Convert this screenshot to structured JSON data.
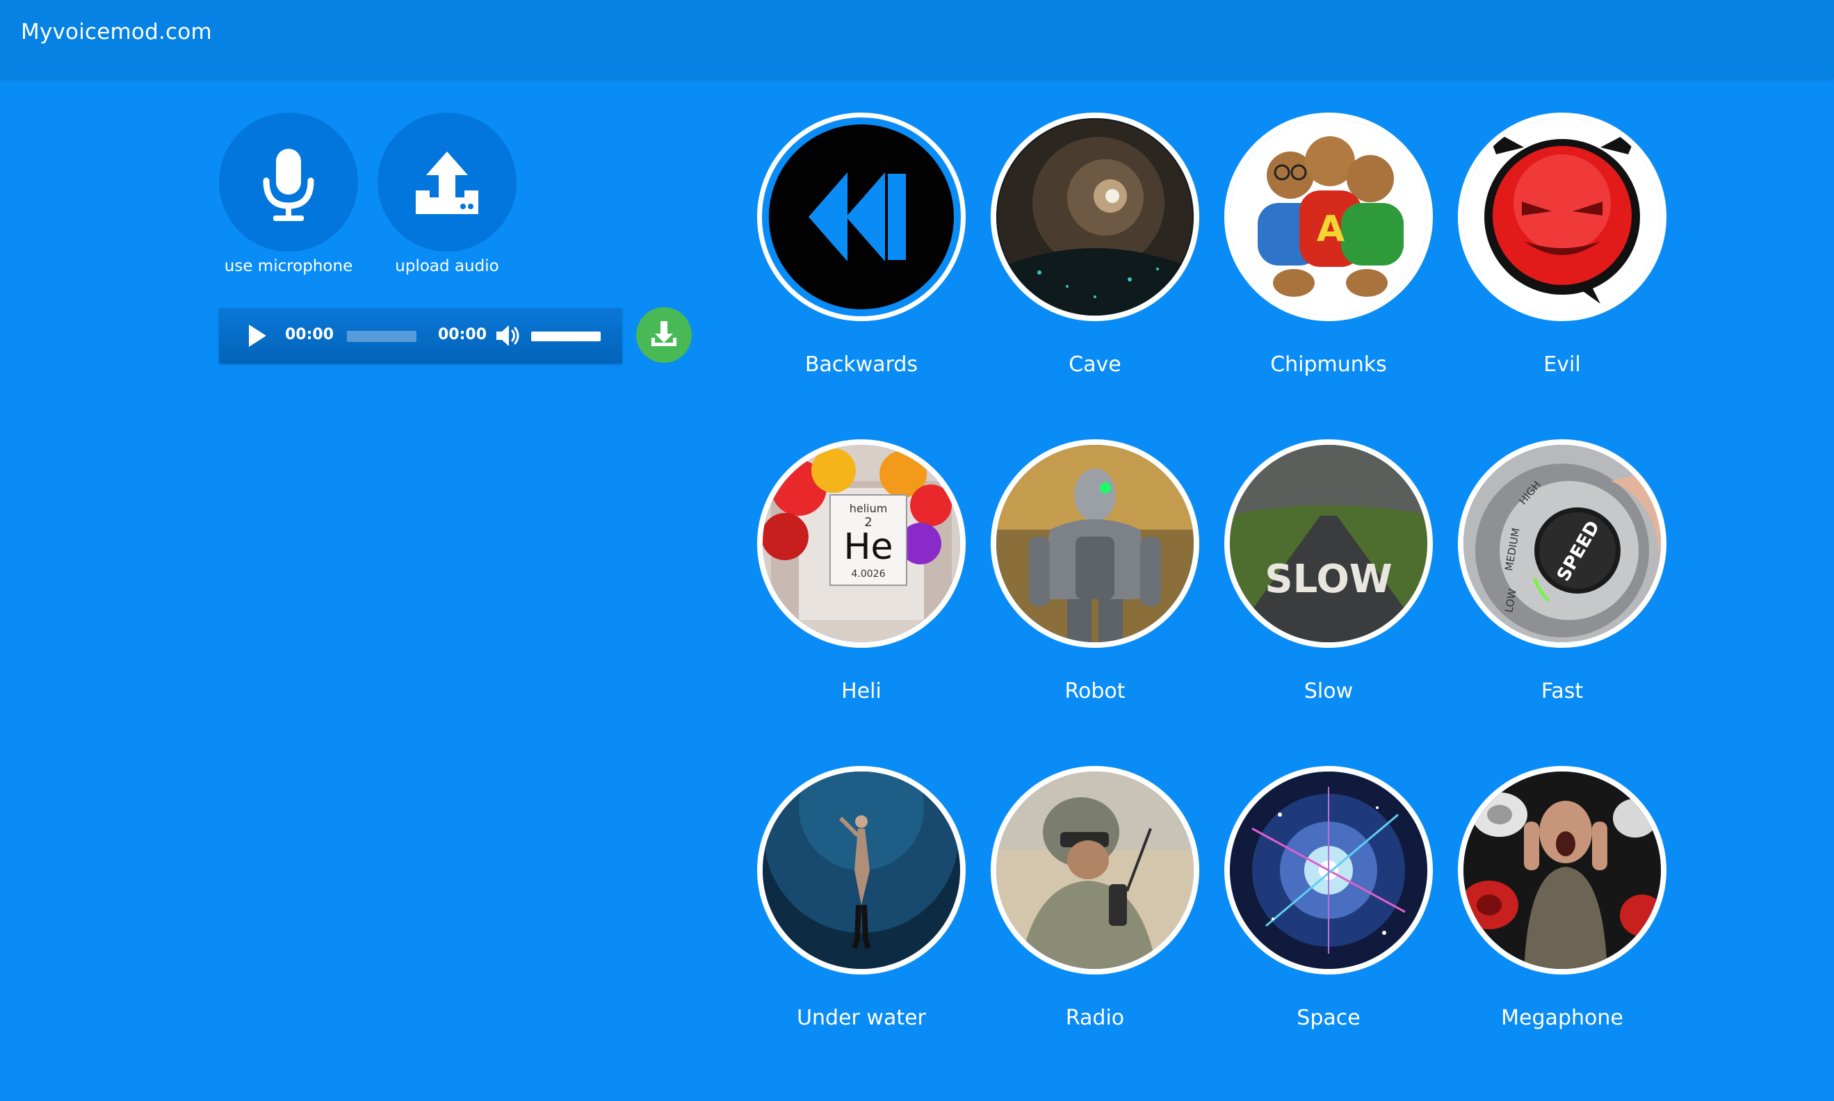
{
  "header": {
    "title": "Myvoicemod.com"
  },
  "inputs": [
    {
      "label": "use microphone",
      "icon": "microphone-icon"
    },
    {
      "label": "upload audio",
      "icon": "upload-icon"
    }
  ],
  "player": {
    "current_time": "00:00",
    "duration": "00:00",
    "progress": 0,
    "volume": 1.0
  },
  "download": {
    "icon": "download-icon",
    "color": "#48b954"
  },
  "effects": [
    {
      "label": "Backwards",
      "selected": true
    },
    {
      "label": "Cave"
    },
    {
      "label": "Chipmunks"
    },
    {
      "label": "Evil"
    },
    {
      "label": "Heli"
    },
    {
      "label": "Robot"
    },
    {
      "label": "Slow"
    },
    {
      "label": "Fast"
    },
    {
      "label": "Under water"
    },
    {
      "label": "Radio"
    },
    {
      "label": "Space"
    },
    {
      "label": "Megaphone"
    }
  ],
  "art_text": {
    "helium_name": "helium",
    "helium_number": "2",
    "helium_symbol": "He",
    "helium_mass": "4.0026",
    "slow_road": "SLOW",
    "fast_knob": "SPEED",
    "fast_low": "LOW",
    "fast_medium": "MEDIUM",
    "fast_high": "HIGH",
    "chipmunk_letter": "A"
  },
  "colors": {
    "background": "#0a8cf7",
    "header": "#0582e4",
    "button": "#0276dc"
  }
}
